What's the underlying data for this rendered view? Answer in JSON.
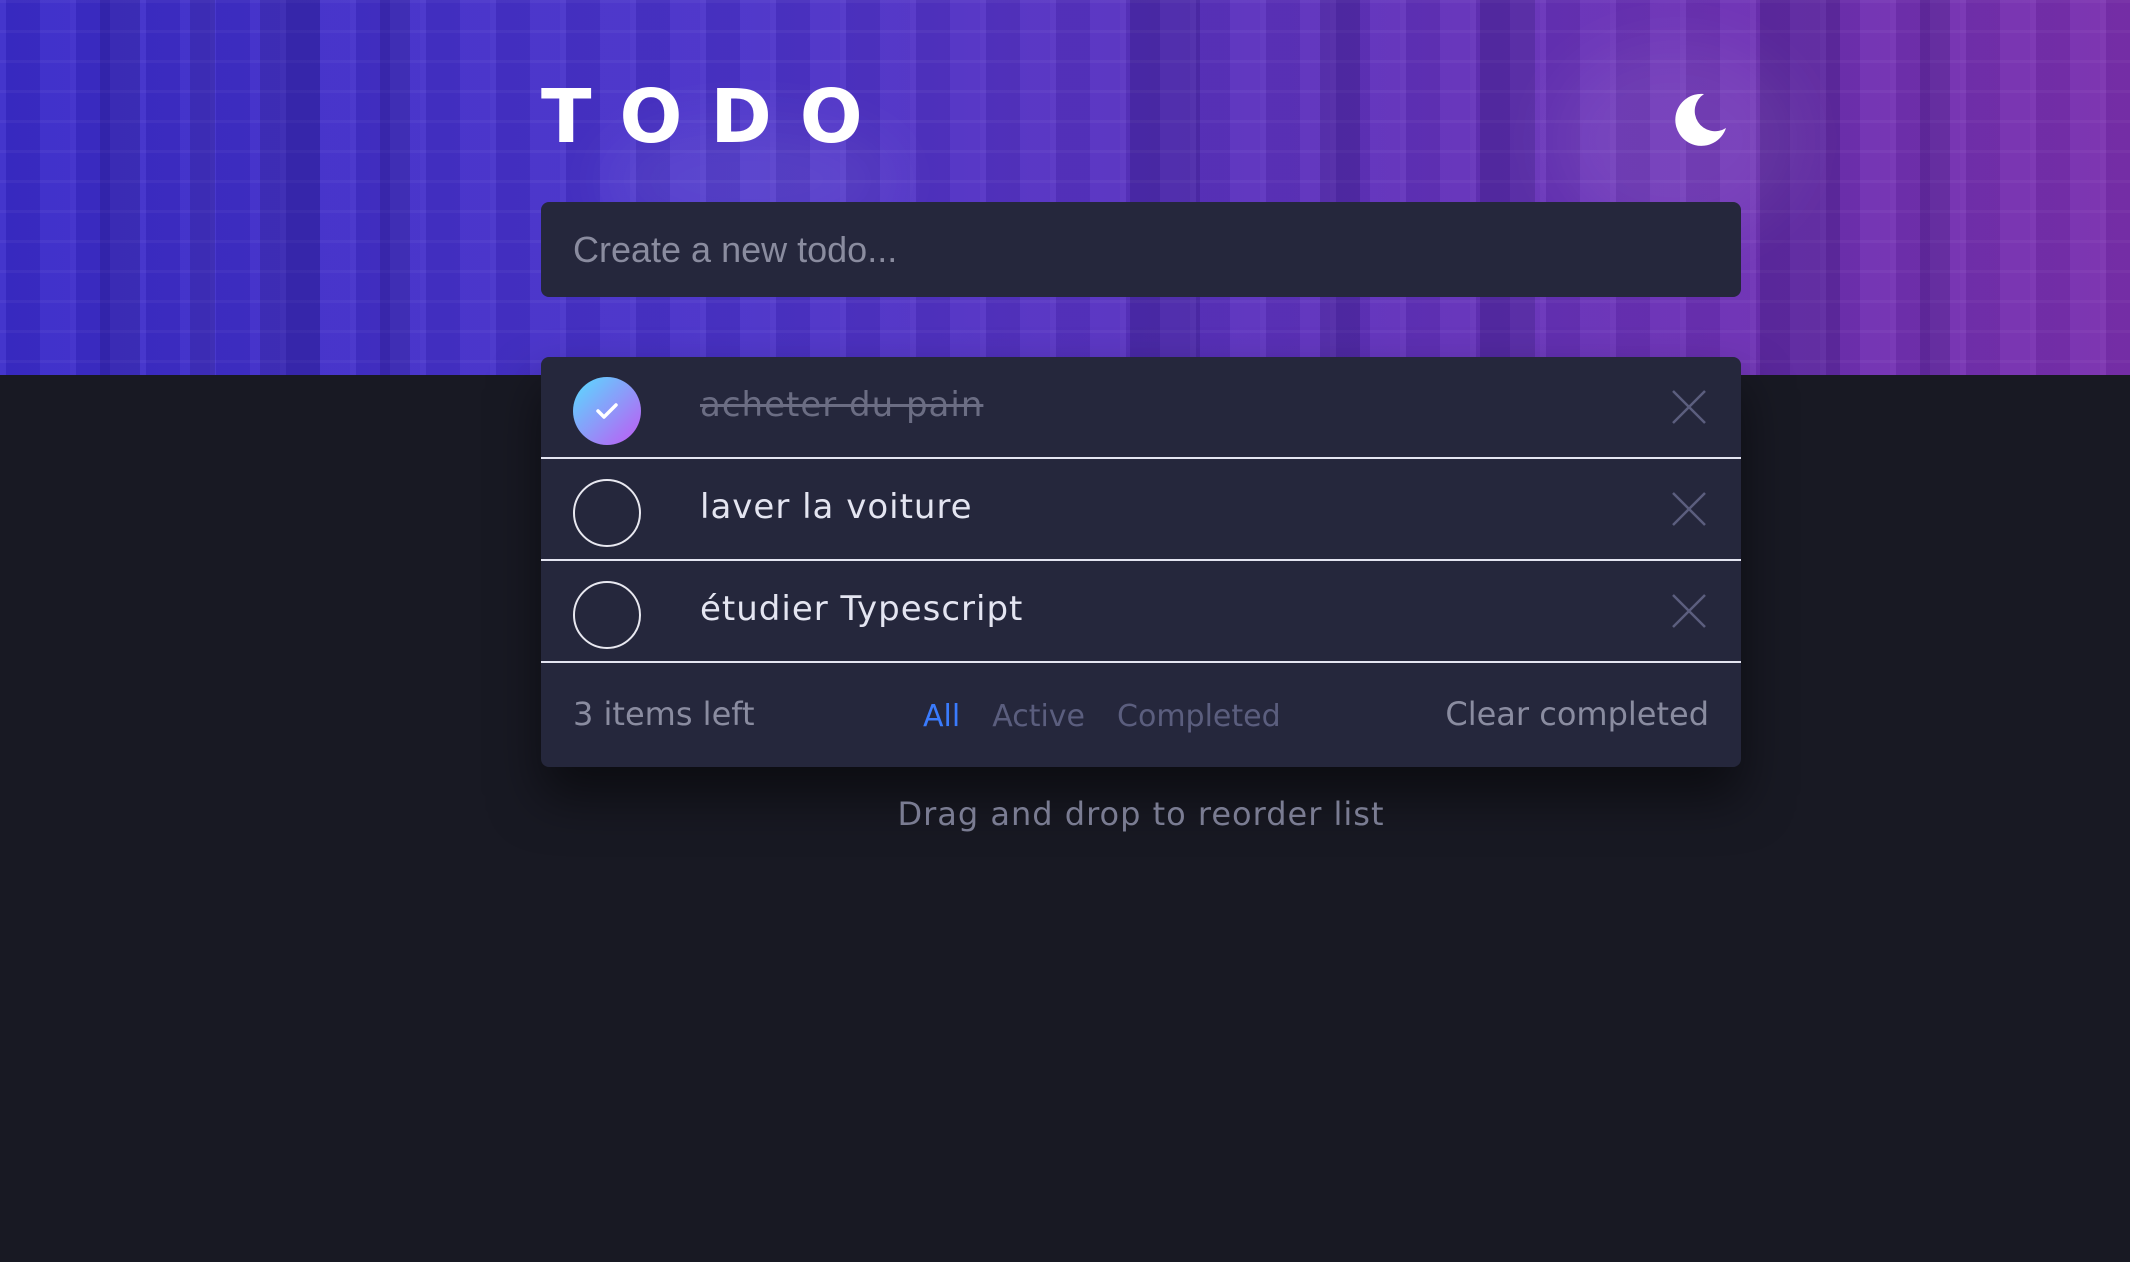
{
  "header": {
    "title": "TODO",
    "theme_icon": "moon-icon"
  },
  "new_todo": {
    "placeholder": "Create a new todo..."
  },
  "todos": [
    {
      "text": "acheter du pain",
      "completed": true
    },
    {
      "text": "laver la voiture",
      "completed": false
    },
    {
      "text": "étudier Typescript",
      "completed": false
    }
  ],
  "footer": {
    "items_left": "3 items left",
    "filters": [
      "All",
      "Active",
      "Completed"
    ],
    "active_filter": "All",
    "clear_label": "Clear completed"
  },
  "hint": "Drag and drop to reorder list",
  "colors": {
    "background": "#181923",
    "card": "#25273c",
    "accent": "#3a7bfd",
    "check_gradient_start": "#57ddff",
    "check_gradient_end": "#c058f3"
  }
}
